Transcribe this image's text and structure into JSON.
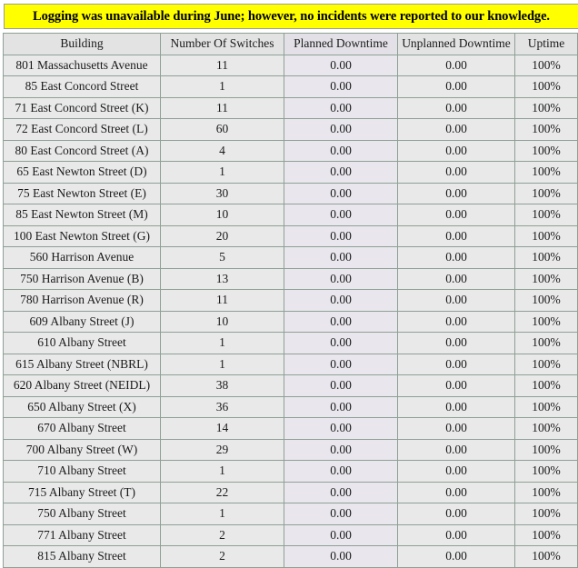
{
  "notice": {
    "text": "Logging was unavailable during June; however, no incidents were reported to our knowledge.",
    "background_color": "#ffff00",
    "border_color": "#9a9a9a"
  },
  "table": {
    "colors": {
      "grid": "#8ea095",
      "header_fill": "#e3e3e3",
      "row_fill": "#e9e9e9",
      "planned_column_fill": "#e9e7ed"
    },
    "columns": [
      "Building",
      "Number Of Switches",
      "Planned Downtime",
      "Unplanned Downtime",
      "Uptime"
    ],
    "rows": [
      {
        "building": "801 Massachusetts Avenue",
        "switches": "11",
        "planned": "0.00",
        "unplanned": "0.00",
        "uptime": "100%"
      },
      {
        "building": "85 East Concord Street",
        "switches": "1",
        "planned": "0.00",
        "unplanned": "0.00",
        "uptime": "100%"
      },
      {
        "building": "71 East Concord Street (K)",
        "switches": "11",
        "planned": "0.00",
        "unplanned": "0.00",
        "uptime": "100%"
      },
      {
        "building": "72 East Concord Street (L)",
        "switches": "60",
        "planned": "0.00",
        "unplanned": "0.00",
        "uptime": "100%"
      },
      {
        "building": "80 East Concord Street (A)",
        "switches": "4",
        "planned": "0.00",
        "unplanned": "0.00",
        "uptime": "100%"
      },
      {
        "building": "65 East Newton Street (D)",
        "switches": "1",
        "planned": "0.00",
        "unplanned": "0.00",
        "uptime": "100%"
      },
      {
        "building": "75 East Newton Street (E)",
        "switches": "30",
        "planned": "0.00",
        "unplanned": "0.00",
        "uptime": "100%"
      },
      {
        "building": "85 East Newton Street (M)",
        "switches": "10",
        "planned": "0.00",
        "unplanned": "0.00",
        "uptime": "100%"
      },
      {
        "building": "100 East Newton Street (G)",
        "switches": "20",
        "planned": "0.00",
        "unplanned": "0.00",
        "uptime": "100%"
      },
      {
        "building": "560 Harrison Avenue",
        "switches": "5",
        "planned": "0.00",
        "unplanned": "0.00",
        "uptime": "100%"
      },
      {
        "building": "750 Harrison Avenue (B)",
        "switches": "13",
        "planned": "0.00",
        "unplanned": "0.00",
        "uptime": "100%"
      },
      {
        "building": "780 Harrison Avenue (R)",
        "switches": "11",
        "planned": "0.00",
        "unplanned": "0.00",
        "uptime": "100%"
      },
      {
        "building": "609 Albany Street (J)",
        "switches": "10",
        "planned": "0.00",
        "unplanned": "0.00",
        "uptime": "100%"
      },
      {
        "building": "610 Albany Street",
        "switches": "1",
        "planned": "0.00",
        "unplanned": "0.00",
        "uptime": "100%"
      },
      {
        "building": "615 Albany Street (NBRL)",
        "switches": "1",
        "planned": "0.00",
        "unplanned": "0.00",
        "uptime": "100%"
      },
      {
        "building": "620 Albany Street (NEIDL)",
        "switches": "38",
        "planned": "0.00",
        "unplanned": "0.00",
        "uptime": "100%"
      },
      {
        "building": "650 Albany Street (X)",
        "switches": "36",
        "planned": "0.00",
        "unplanned": "0.00",
        "uptime": "100%"
      },
      {
        "building": "670 Albany Street",
        "switches": "14",
        "planned": "0.00",
        "unplanned": "0.00",
        "uptime": "100%"
      },
      {
        "building": "700 Albany Street (W)",
        "switches": "29",
        "planned": "0.00",
        "unplanned": "0.00",
        "uptime": "100%"
      },
      {
        "building": "710 Albany Street",
        "switches": "1",
        "planned": "0.00",
        "unplanned": "0.00",
        "uptime": "100%"
      },
      {
        "building": "715 Albany Street (T)",
        "switches": "22",
        "planned": "0.00",
        "unplanned": "0.00",
        "uptime": "100%"
      },
      {
        "building": "750 Albany Street",
        "switches": "1",
        "planned": "0.00",
        "unplanned": "0.00",
        "uptime": "100%"
      },
      {
        "building": "771 Albany Street",
        "switches": "2",
        "planned": "0.00",
        "unplanned": "0.00",
        "uptime": "100%"
      },
      {
        "building": "815 Albany Street",
        "switches": "2",
        "planned": "0.00",
        "unplanned": "0.00",
        "uptime": "100%"
      }
    ]
  }
}
